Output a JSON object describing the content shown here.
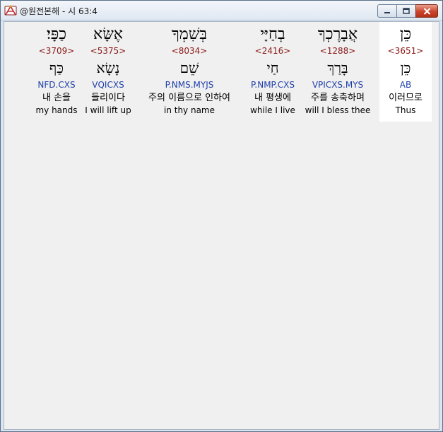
{
  "window": {
    "title": "@원전본해 - 시 63:4",
    "icon": "bible-app-icon",
    "buttons": [
      "minimize-icon",
      "maximize-icon",
      "close-icon"
    ]
  },
  "colors": {
    "strong": "#8b1a1a",
    "morph": "#1e3fa8",
    "content_bg": "#f0f0f0",
    "selected_bg": "#ffffff",
    "close_button": "#c9452b"
  },
  "words": [
    {
      "hebrew": "כֵּן",
      "strong": "<3651>",
      "lemma": "כֵּן",
      "morph": "AB",
      "korean": "이러므로",
      "english": "Thus",
      "selected": true
    },
    {
      "hebrew": "אֲבָרֶכְךָ",
      "strong": "<1288>",
      "lemma": "בָּרַךְ",
      "morph": "VPICXS.MYS",
      "korean": "주를 송축하며",
      "english": "will I bless thee",
      "selected": false
    },
    {
      "hebrew": "בְחַיָּי",
      "strong": "<2416>",
      "lemma": "חַי",
      "morph": "P.NMP.CXS",
      "korean": "내 평생에",
      "english": "while I live",
      "selected": false
    },
    {
      "hebrew": "בְּשִׁמְךָ",
      "strong": "<8034>",
      "lemma": "שֵׁם",
      "morph": "P.NMS.MYJS",
      "korean": "주의 이름으로 인하여",
      "english": "in thy name",
      "selected": false
    },
    {
      "hebrew": "אֶשָּׂא",
      "strong": "<5375>",
      "lemma": "נָשָׂא",
      "morph": "VQICXS",
      "korean": "들리이다",
      "english": "I will lift up",
      "selected": false
    },
    {
      "hebrew": "כַפָּי׃",
      "strong": "<3709>",
      "lemma": "כַּף",
      "morph": "NFD.CXS",
      "korean": "내 손을",
      "english": "my hands",
      "selected": false
    }
  ]
}
